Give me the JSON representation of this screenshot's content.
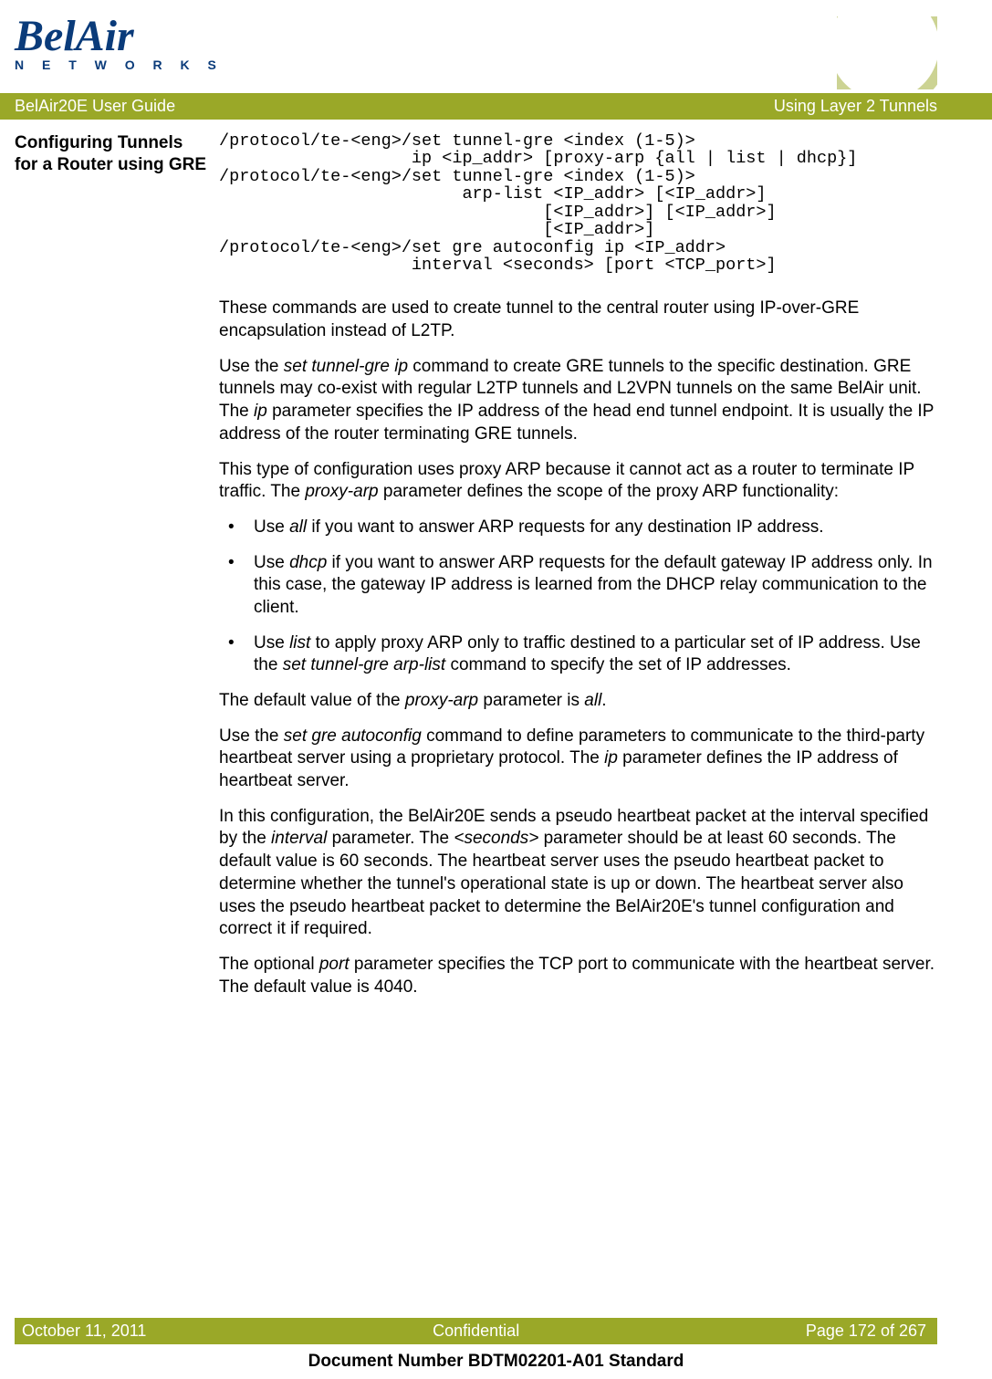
{
  "logo": {
    "brand": "BelAir",
    "sub": "N E T W O R K S"
  },
  "header": {
    "left": "BelAir20E User Guide",
    "right": "Using Layer 2 Tunnels"
  },
  "section_heading": "Configuring Tunnels for a Router using GRE",
  "code": "/protocol/te-<eng>/set tunnel-gre <index (1-5)>\n                   ip <ip_addr> [proxy-arp {all | list | dhcp}]\n/protocol/te-<eng>/set tunnel-gre <index (1-5)> \n                        arp-list <IP_addr> [<IP_addr>]\n                                [<IP_addr>] [<IP_addr>]\n                                [<IP_addr>]\n/protocol/te-<eng>/set gre autoconfig ip <IP_addr>\n                   interval <seconds> [port <TCP_port>]",
  "p1": "These commands are used to create tunnel to the central router using IP-over-GRE encapsulation instead of L2TP.",
  "p2a": "Use the ",
  "p2b": "set tunnel-gre ip",
  "p2c": " command to create GRE tunnels to the specific destination. GRE tunnels may co-exist with regular L2TP tunnels and L2VPN tunnels on the same BelAir unit. The ",
  "p2d": "ip",
  "p2e": " parameter specifies the IP address of the head end tunnel endpoint. It is usually the IP address of the router terminating GRE tunnels.",
  "p3a": "This type of configuration uses proxy ARP because it cannot act as a router to terminate IP traffic. The ",
  "p3b": "proxy-arp",
  "p3c": " parameter defines the scope of the proxy ARP functionality:",
  "li1a": "Use ",
  "li1b": "all",
  "li1c": " if you want to answer ARP requests for any destination IP address.",
  "li2a": "Use ",
  "li2b": "dhcp",
  "li2c": " if you want to answer ARP requests for the default gateway IP address only. In this case, the gateway IP address is learned from the DHCP relay communication to the client.",
  "li3a": "Use ",
  "li3b": "list",
  "li3c": " to apply proxy ARP only to traffic destined to a particular set of IP address. Use the ",
  "li3d": "set tunnel-gre arp-list",
  "li3e": " command to specify the set of IP addresses.",
  "p4a": "The default value of the ",
  "p4b": "proxy-arp",
  "p4c": " parameter is ",
  "p4d": "all",
  "p4e": ".",
  "p5a": "Use the ",
  "p5b": "set gre autoconfig",
  "p5c": " command to define parameters to communicate to the third-party heartbeat server using a proprietary protocol. The ",
  "p5d": "ip",
  "p5e": " parameter defines the IP address of heartbeat server.",
  "p6a": "In this configuration, the BelAir20E sends a pseudo heartbeat packet at the interval specified by the ",
  "p6b": "interval",
  "p6c": " parameter. The ",
  "p6d": "<seconds>",
  "p6e": " parameter should be at least 60 seconds. The default value is 60 seconds. The heartbeat server uses the pseudo heartbeat packet to determine whether the tunnel's operational state is up or down. The heartbeat server also uses the pseudo heartbeat packet to determine the BelAir20E's tunnel configuration and correct it if required.",
  "p7a": "The optional ",
  "p7b": "port",
  "p7c": " parameter specifies the TCP port to communicate with the heartbeat server. The default value is 4040.",
  "footer": {
    "date": "October 11, 2011",
    "center": "Confidential",
    "page": "Page 172 of 267"
  },
  "doc_number": "Document Number BDTM02201-A01 Standard"
}
